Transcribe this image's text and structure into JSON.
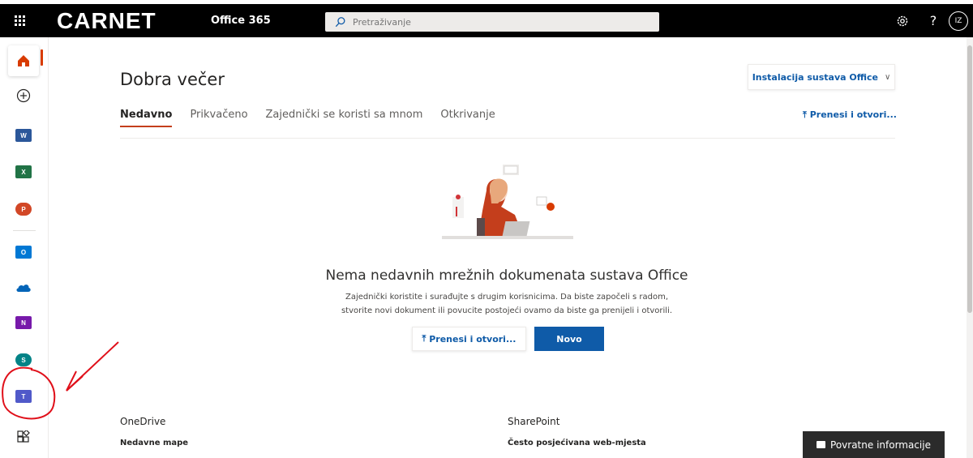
{
  "header": {
    "brand": "CARNET",
    "app_name": "Office 365",
    "search_placeholder": "Pretraživanje",
    "avatar_initials": "IZ",
    "help_glyph": "?"
  },
  "rail": {
    "apps": [
      {
        "name": "home",
        "letter": ""
      },
      {
        "name": "create",
        "letter": ""
      },
      {
        "name": "word",
        "letter": "W",
        "color": "#2b579a"
      },
      {
        "name": "excel",
        "letter": "X",
        "color": "#217346"
      },
      {
        "name": "powerpoint",
        "letter": "P",
        "color": "#d24726"
      },
      {
        "name": "outlook",
        "letter": "O",
        "color": "#0078d4"
      },
      {
        "name": "onedrive",
        "letter": "",
        "color": "#0364b8"
      },
      {
        "name": "onenote",
        "letter": "N",
        "color": "#7719aa"
      },
      {
        "name": "sharepoint",
        "letter": "S",
        "color": "#038387"
      },
      {
        "name": "teams",
        "letter": "T",
        "color": "#5059c9"
      },
      {
        "name": "all-apps",
        "letter": ""
      }
    ]
  },
  "main": {
    "greeting": "Dobra večer",
    "install_label": "Instalacija sustava Office",
    "tabs": [
      {
        "label": "Nedavno",
        "active": true
      },
      {
        "label": "Prikvačeno",
        "active": false
      },
      {
        "label": "Zajednički se koristi sa mnom",
        "active": false
      },
      {
        "label": "Otkrivanje",
        "active": false
      }
    ],
    "upload_open_label": "Prenesi i otvori...",
    "empty_title": "Nema nedavnih mrežnih dokumenata sustava Office",
    "empty_desc_line1": "Zajednički koristite i surađujte s drugim korisnicima. Da biste započeli s radom,",
    "empty_desc_line2": "stvorite novi dokument ili povucite postojeći ovamo da biste ga prenijeli i otvorili.",
    "button_upload": "Prenesi i otvori...",
    "button_new": "Novo"
  },
  "sections": {
    "onedrive_title": "OneDrive",
    "onedrive_sub": "Nedavne mape",
    "sharepoint_title": "SharePoint",
    "sharepoint_sub": "Često posjećivana web-mjesta"
  },
  "feedback": {
    "label": "Povratne informacije"
  },
  "colors": {
    "accent_blue": "#0f5ba8",
    "tab_underline": "#c43e1c",
    "annotation_red": "#e0101a"
  }
}
